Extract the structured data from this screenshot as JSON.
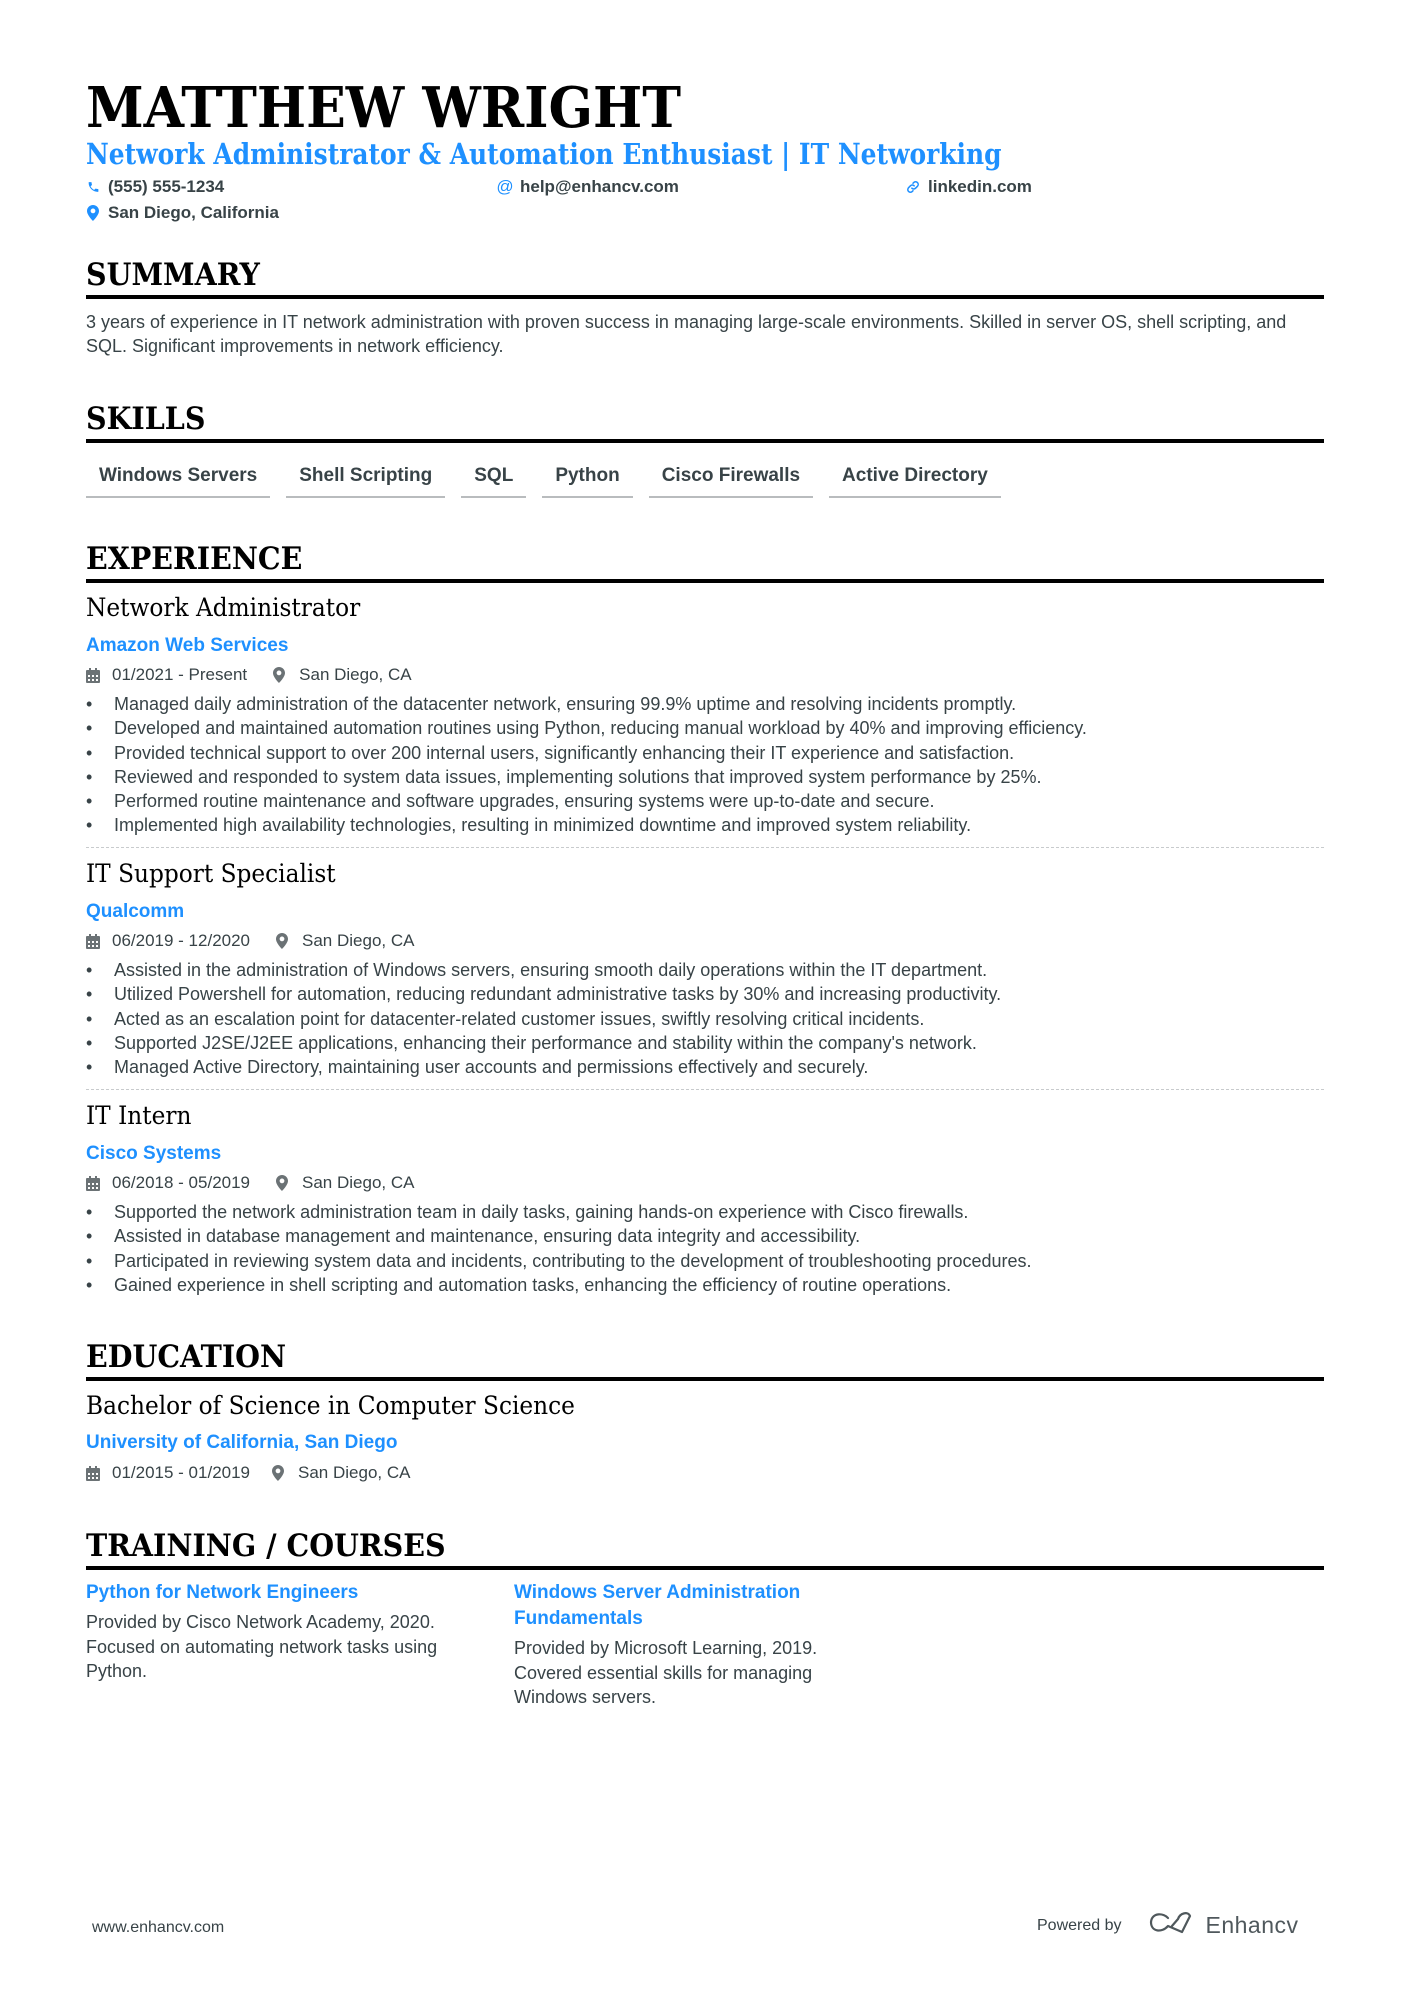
{
  "header": {
    "name": "MATTHEW WRIGHT",
    "title": "Network Administrator & Automation Enthusiast | IT Networking",
    "contacts": [
      {
        "icon": "phone-icon",
        "text": "(555) 555-1234"
      },
      {
        "icon": "at-icon",
        "text": "help@enhancv.com"
      },
      {
        "icon": "link-icon",
        "text": "linkedin.com"
      },
      {
        "icon": "location-pin-icon",
        "text": "San Diego, California"
      }
    ]
  },
  "summary": {
    "heading": "SUMMARY",
    "text": "3 years of experience in IT network administration with proven success in managing large-scale environments. Skilled in server OS, shell scripting, and SQL. Significant improvements in network efficiency."
  },
  "skills": {
    "heading": "SKILLS",
    "items": [
      "Windows Servers",
      "Shell Scripting",
      "SQL",
      "Python",
      "Cisco Firewalls",
      "Active Directory"
    ]
  },
  "experience": {
    "heading": "EXPERIENCE",
    "jobs": [
      {
        "title": "Network Administrator",
        "company": "Amazon Web Services",
        "dates": "01/2021 - Present",
        "location": "San Diego, CA",
        "bullets": [
          "Managed daily administration of the datacenter network, ensuring 99.9% uptime and resolving incidents promptly.",
          "Developed and maintained automation routines using Python, reducing manual workload by 40% and improving efficiency.",
          "Provided technical support to over 200 internal users, significantly enhancing their IT experience and satisfaction.",
          "Reviewed and responded to system data issues, implementing solutions that improved system performance by 25%.",
          "Performed routine maintenance and software upgrades, ensuring systems were up-to-date and secure.",
          "Implemented high availability technologies, resulting in minimized downtime and improved system reliability."
        ]
      },
      {
        "title": "IT Support Specialist",
        "company": "Qualcomm",
        "dates": "06/2019 - 12/2020",
        "location": "San Diego, CA",
        "bullets": [
          "Assisted in the administration of Windows servers, ensuring smooth daily operations within the IT department.",
          "Utilized Powershell for automation, reducing redundant administrative tasks by 30% and increasing productivity.",
          "Acted as an escalation point for datacenter-related customer issues, swiftly resolving critical incidents.",
          "Supported J2SE/J2EE applications, enhancing their performance and stability within the company's network.",
          "Managed Active Directory, maintaining user accounts and permissions effectively and securely."
        ]
      },
      {
        "title": "IT Intern",
        "company": "Cisco Systems",
        "dates": "06/2018 - 05/2019",
        "location": "San Diego, CA",
        "bullets": [
          "Supported the network administration team in daily tasks, gaining hands-on experience with Cisco firewalls.",
          "Assisted in database management and maintenance, ensuring data integrity and accessibility.",
          "Participated in reviewing system data and incidents, contributing to the development of troubleshooting procedures.",
          "Gained experience in shell scripting and automation tasks, enhancing the efficiency of routine operations."
        ]
      }
    ]
  },
  "education": {
    "heading": "EDUCATION",
    "degree": "Bachelor of Science in Computer Science",
    "school": "University of California, San Diego",
    "dates": "01/2015 - 01/2019",
    "location": "San Diego, CA"
  },
  "training": {
    "heading": "TRAINING / COURSES",
    "courses": [
      {
        "title": "Python for Network Engineers",
        "description": "Provided by Cisco Network Academy, 2020. Focused on automating network tasks using Python."
      },
      {
        "title": "Windows Server Administration Fundamentals",
        "description": "Provided by Microsoft Learning, 2019. Covered essential skills for managing Windows servers."
      }
    ]
  },
  "footer": {
    "website": "www.enhancv.com",
    "powered_by": "Powered by",
    "brand": "Enhancv"
  },
  "colors": {
    "accent": "#1e90ff",
    "text": "#384347",
    "heading": "#000000"
  }
}
